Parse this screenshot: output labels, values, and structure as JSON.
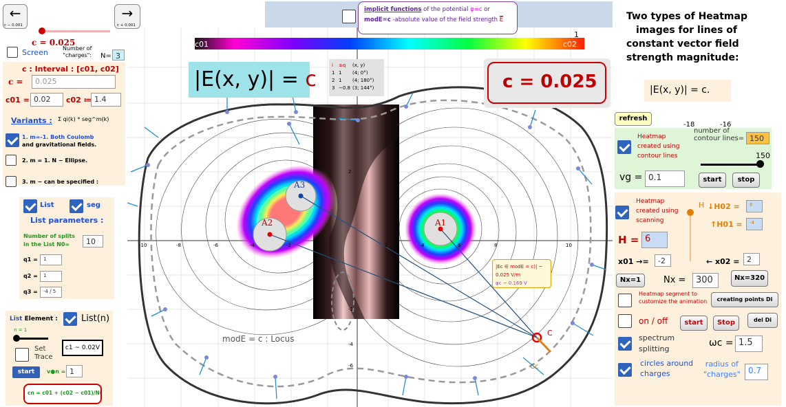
{
  "nav": {
    "back_label": "c − 0.001",
    "forward_label": "c + 0.001",
    "c_display": "c = 0.025"
  },
  "left": {
    "screen_label": "Screen",
    "charges_label_line1": "Number of",
    "charges_label_line2": "\"charges\":",
    "n_label": "N=",
    "n_value": "3",
    "interval_title": "c :  Interval : [c01, c02]",
    "c_label": "c =",
    "c_value": "0.025",
    "c01_label": "c01 =",
    "c01_value": "0.02",
    "c02_label": "c02 ≔",
    "c02_value": "1.4",
    "variants_label": "Variants :",
    "variants_formula": "Σ qi(k) * seg^m(k)",
    "variant1": "1. m=-1. Both Coulomb",
    "variant1b": "and gravitational fields.",
    "variant2": "2. m = 1. N − Ellipse.",
    "variant3": "3. m − can be specified :",
    "list_label": "List",
    "seg_label": "seg",
    "list_params": "List parameters :",
    "splits_line1": "Number of splits",
    "splits_line2": "in the List  N0=",
    "splits_value": "10",
    "q1_label": "q1 =",
    "q1_value": "1",
    "q2_label": "q2 =",
    "q2_value": "1",
    "q3_label": "q3 =",
    "q3_value": "-4 / 5",
    "list_element_a": "List",
    "list_element_b": "Element :",
    "list_n": "List(n)",
    "n_eq": "n = 1",
    "set_trace_a": "Set",
    "set_trace_b": "Trace",
    "c1_box": "c1 ~ 0.02V",
    "start_label": "start",
    "vn_label": "v●n =",
    "vn_value": "1",
    "cn_formula": "cn = c01 + (c02 − c01)/N0 • n"
  },
  "top": {
    "implicit_line1a": "implicit functions",
    "implicit_line1b": " of the potential ",
    "implicit_line1c": "φ=c",
    "implicit_line1d": "  or",
    "implicit_line2a": "modE=c",
    "implicit_line2b": " -absolute value of the field strength ",
    "implicit_line2c": "E",
    "colorbar_min": "c01",
    "colorbar_max": "c02",
    "colorbar_top": "1"
  },
  "canvas": {
    "formula": "|E(x, y)| = ",
    "formula_c": "c",
    "c_big": "c = 0.025",
    "charge_table": [
      [
        "i",
        "±q",
        "(x, y)"
      ],
      [
        "1",
        "1",
        "(4; 0°)"
      ],
      [
        "2",
        "1",
        "(4; 180°)"
      ],
      [
        "3",
        "−0.8",
        "(3; 144°)"
      ]
    ],
    "A1": "A1",
    "A2": "A2",
    "A3": "A3",
    "locus_a": "modE = c",
    "locus_b": " :  Locus",
    "info_line1": "|Ec ∈ modE = c)| ~ 0.025 V/m",
    "info_line2": "φc ~ 0.169 V",
    "point_C": "C",
    "point_Cc": "Cc",
    "ticks_x": [
      "-10",
      "-8",
      "-6",
      "-4",
      "-2",
      "2",
      "4",
      "6",
      "8",
      "10"
    ],
    "ticks_top": [
      "-18",
      "-16"
    ],
    "ticks_y": [
      "2",
      "-2",
      "-4",
      "-6"
    ]
  },
  "right": {
    "title_line1": "Two types of Heatmap",
    "title_line2": "images for lines of",
    "title_line3": "constant vector field",
    "title_line4": "strength magnitude:",
    "title_formula": "|E(x, y)| = c.",
    "refresh": "refresh",
    "heatmap1_a": "Heatmap",
    "heatmap1_b": "created using",
    "heatmap1_c": "contour lines",
    "contour_label_a": "number of",
    "contour_label_b": "contour lines=",
    "contour_value": "150",
    "slider_value": "150",
    "vg_label": "vg =",
    "vg_value": "0.1",
    "start": "start",
    "stop": "stop",
    "heatmap2_a": "Heatmap",
    "heatmap2_b": "created using",
    "heatmap2_c": "scanning",
    "H_label": "H =",
    "H_value": "6",
    "H_small": "H",
    "H02_label": "↓H02 =",
    "H02_value": "6",
    "H01_label": "↑H01 =",
    "H01_value": "-4",
    "x01_label": "x01 →=",
    "x01_value": "-2",
    "x02_label": "← x02 =",
    "x02_value": "2",
    "nx1": "Nx=1",
    "nx_label": "Nx =",
    "nx_value": "300",
    "nx320": "Nx=320",
    "seg_anim_a": "Heatmap segment to",
    "seg_anim_b": "customize the animation",
    "creating_points": "creating points Di",
    "onoff": "on / off",
    "start2": "start",
    "stop2": "Stop",
    "del": "del Di",
    "spectrum_a": "spectrum",
    "spectrum_b": "splitting",
    "omega_label": "ωc =",
    "omega_value": "1.5",
    "circles_a": "circles around",
    "circles_b": "charges",
    "radius_a": "radius of",
    "radius_b": "\"charges\"",
    "radius_value": "0.7"
  },
  "colors": {
    "panel": "#fdf0dc",
    "accent": "#2f63bd",
    "charge_red": "#e00000",
    "c_red": "#c00000",
    "green_panel": "#dff5d8",
    "top_bar": "#c9d9ea"
  }
}
